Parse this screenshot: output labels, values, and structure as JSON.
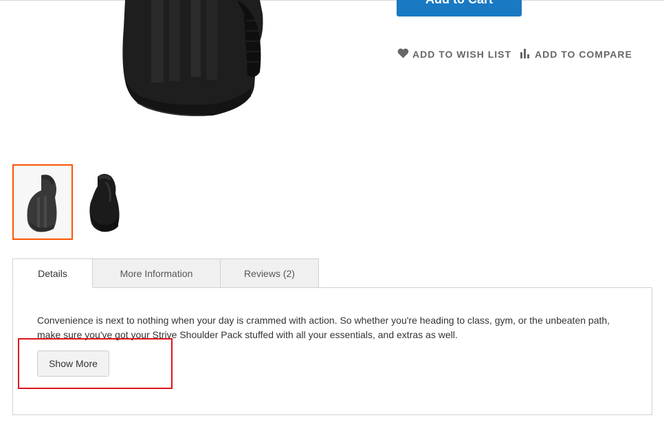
{
  "product": {
    "add_to_cart_label": "Add to Cart",
    "wish_list_label": "ADD TO WISH LIST",
    "compare_label": "ADD TO COMPARE",
    "thumbnails": [
      {
        "name": "thumbnail-1",
        "active": true
      },
      {
        "name": "thumbnail-2",
        "active": false
      }
    ]
  },
  "tabs": [
    {
      "label": "Details",
      "active": true
    },
    {
      "label": "More Information",
      "active": false
    },
    {
      "label": "Reviews (2)",
      "active": false
    }
  ],
  "details": {
    "description": "Convenience is next to nothing when your day is crammed with action. So whether you're heading to class, gym, or the unbeaten path, make sure you've got your Strive Shoulder Pack stuffed with all your essentials, and extras as well.",
    "show_more_label": "Show More"
  },
  "colors": {
    "primary_button": "#1979c3",
    "active_thumbnail_border": "#ff5501",
    "highlight_border": "#e0131b"
  },
  "icons": {
    "wish_list": "heart-icon",
    "compare": "bar-chart-icon"
  }
}
